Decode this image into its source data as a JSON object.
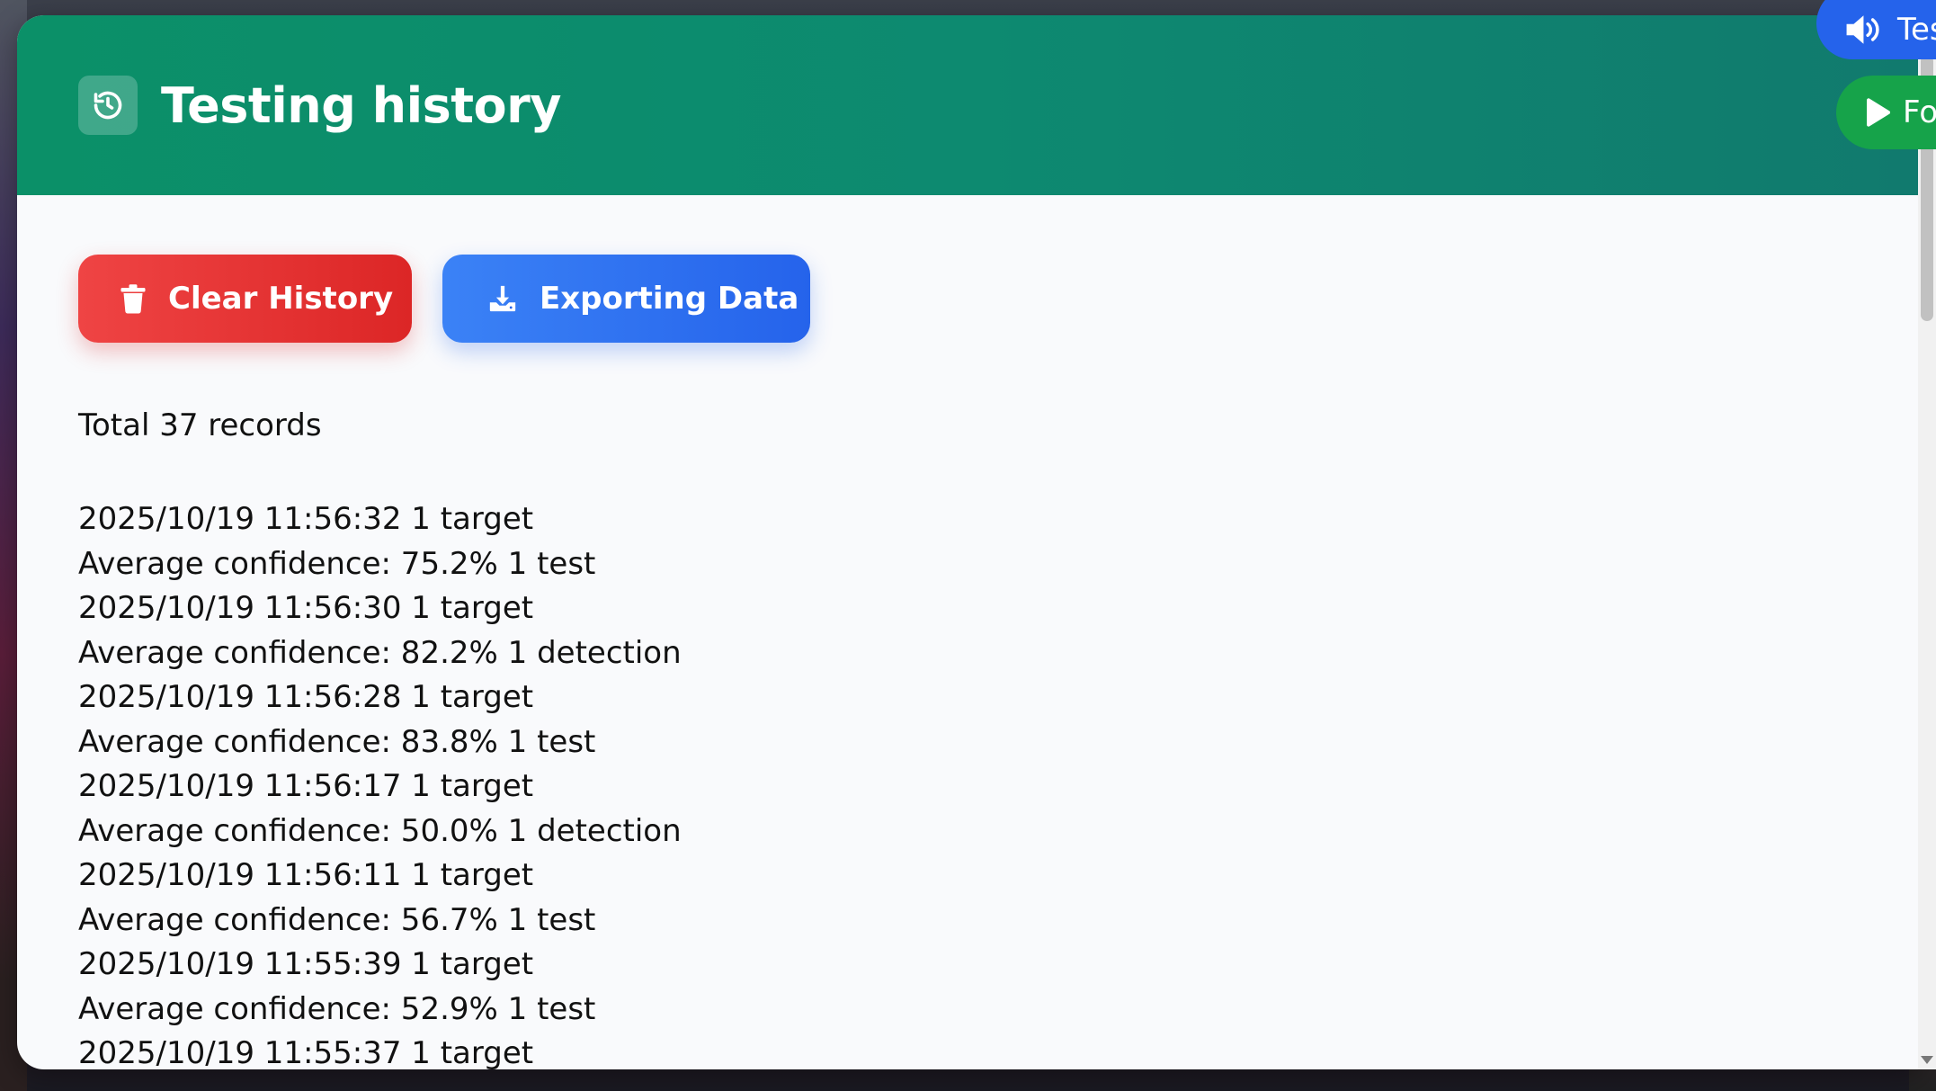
{
  "header": {
    "title": "Testing history",
    "icon": "history-icon"
  },
  "actions": {
    "clear_label": "Clear History",
    "clear_icon": "trash-icon",
    "export_label": "Exporting Data",
    "export_icon": "download-icon"
  },
  "summary": {
    "total_text": "Total 37 records"
  },
  "records": [
    {
      "line1": "2025/10/19 11:56:32 1 target",
      "line2": "Average confidence: 75.2% 1 test"
    },
    {
      "line1": "2025/10/19 11:56:30 1 target",
      "line2": "Average confidence: 82.2% 1 detection"
    },
    {
      "line1": "2025/10/19 11:56:28 1 target",
      "line2": "Average confidence: 83.8% 1 test"
    },
    {
      "line1": "2025/10/19 11:56:17 1 target",
      "line2": "Average confidence: 50.0% 1 detection"
    },
    {
      "line1": "2025/10/19 11:56:11 1 target",
      "line2": "Average confidence: 56.7% 1 test"
    },
    {
      "line1": "2025/10/19 11:55:39 1 target",
      "line2": "Average confidence: 52.9% 1 test"
    },
    {
      "line1": "2025/10/19 11:55:37 1 target"
    }
  ],
  "floating": {
    "voice_label": "Tes",
    "voice_icon": "speaker-icon",
    "play_label": "Fo",
    "play_icon": "play-icon"
  },
  "colors": {
    "header_start": "#0b9068",
    "header_end": "#117a6e",
    "clear_button": "#dc2626",
    "export_button": "#2563eb",
    "play_button": "#16a34a"
  }
}
